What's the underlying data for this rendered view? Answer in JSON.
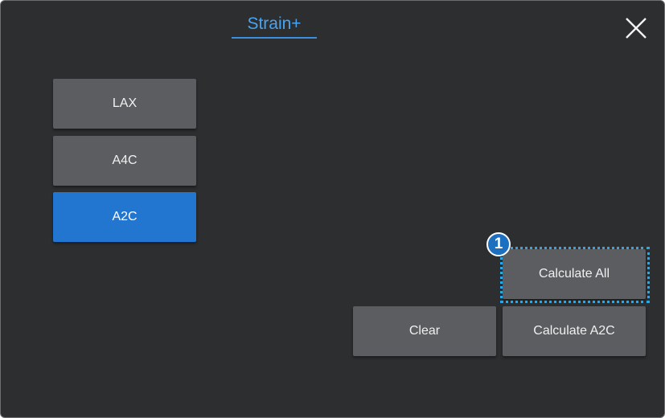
{
  "header": {
    "title": "Strain+",
    "close_icon": "close-icon"
  },
  "views": [
    {
      "label": "LAX",
      "selected": false
    },
    {
      "label": "A4C",
      "selected": false
    },
    {
      "label": "A2C",
      "selected": true
    }
  ],
  "actions": {
    "calculate_all_label": "Calculate All",
    "clear_label": "Clear",
    "calculate_a2c_label": "Calculate A2C"
  },
  "callout": {
    "number": "1"
  },
  "colors": {
    "background": "#2d2e30",
    "button": "#5b5d60",
    "selected": "#2376d0",
    "title": "#4aa3f0",
    "highlight": "#2aa7e4"
  }
}
